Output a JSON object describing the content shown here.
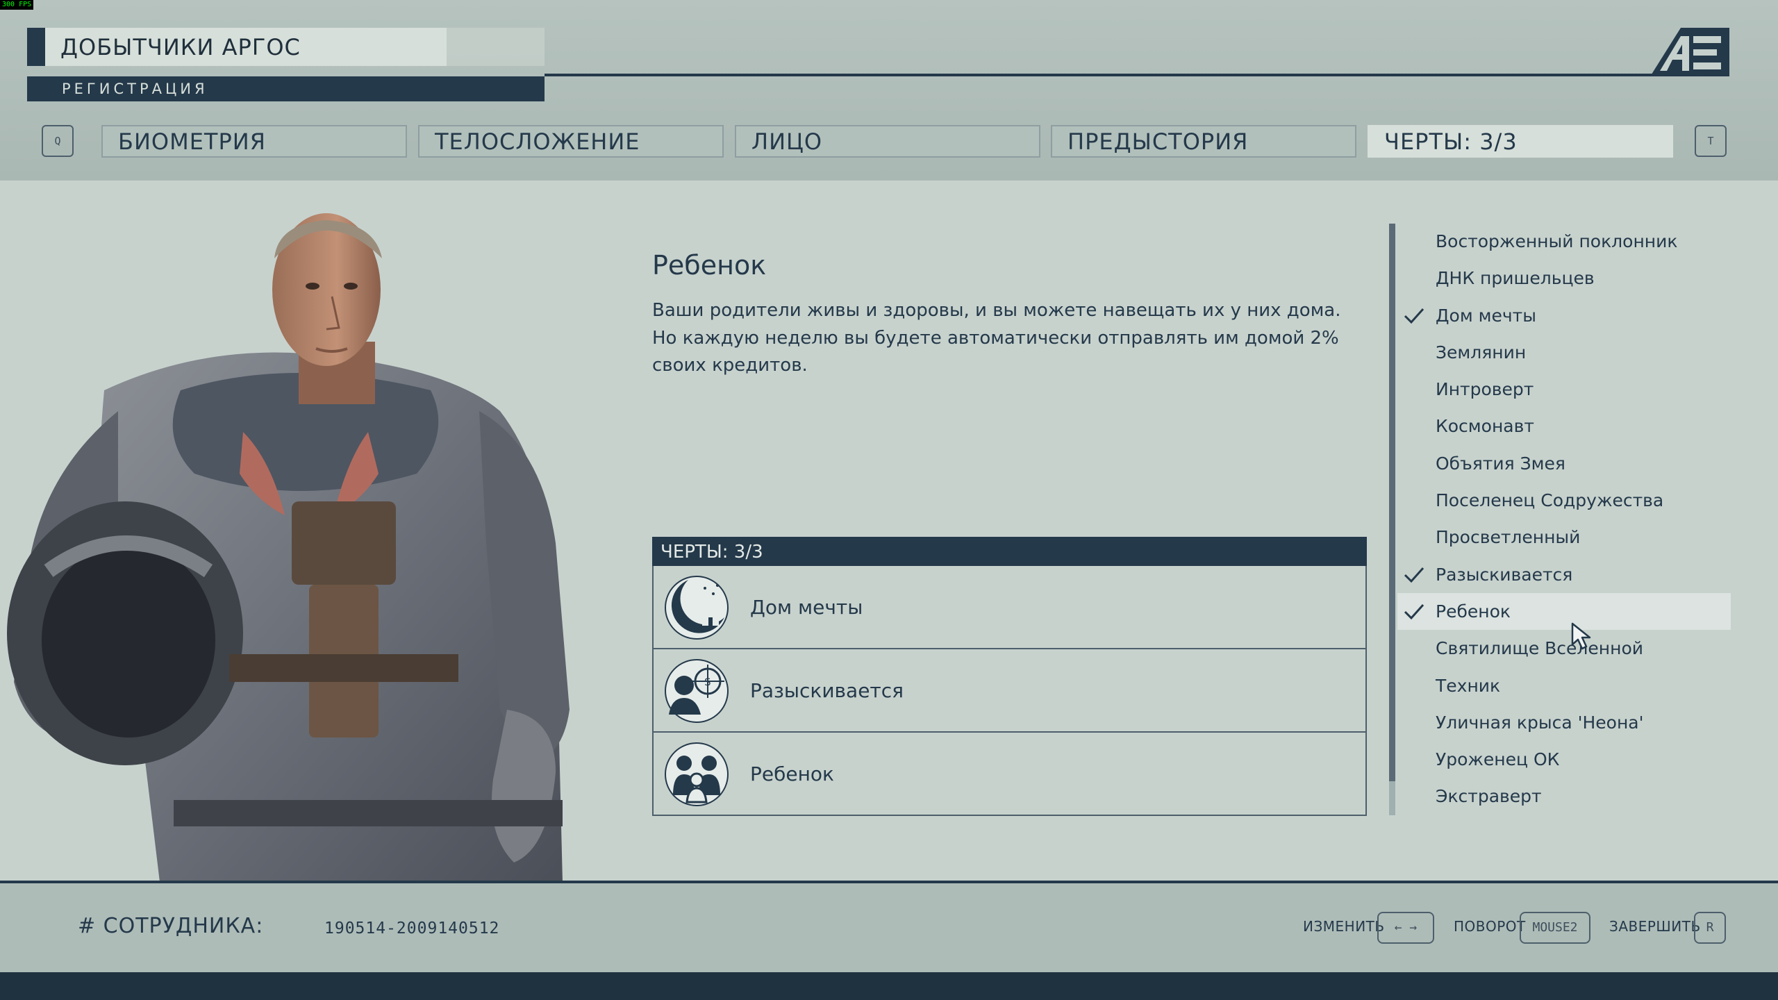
{
  "debug": {
    "fps": "300 FPS"
  },
  "header": {
    "company": "ДОБЫТЧИКИ АРГОС",
    "section": "РЕГИСТРАЦИЯ",
    "prev_key": "Q",
    "next_key": "T",
    "tabs": [
      {
        "label": "БИОМЕТРИЯ",
        "active": false
      },
      {
        "label": "ТЕЛОСЛОЖЕНИЕ",
        "active": false
      },
      {
        "label": "ЛИЦО",
        "active": false
      },
      {
        "label": "ПРЕДЫСТОРИЯ",
        "active": false
      },
      {
        "label": "ЧЕРТЫ: 3/3",
        "active": true
      }
    ]
  },
  "detail": {
    "title": "Ребенок",
    "description": "Ваши родители живы и здоровы, и вы можете навещать их у них дома. Но каждую неделю вы будете автоматически отправлять им домой 2% своих кредитов."
  },
  "selected_traits": {
    "header": "ЧЕРТЫ: 3/3",
    "items": [
      {
        "name": "Дом мечты",
        "icon": "dream-home-icon"
      },
      {
        "name": "Разыскивается",
        "icon": "wanted-icon"
      },
      {
        "name": "Ребенок",
        "icon": "kid-stuff-icon"
      }
    ]
  },
  "trait_list": [
    {
      "name": "Восторженный поклонник",
      "checked": false
    },
    {
      "name": "ДНК пришельцев",
      "checked": false
    },
    {
      "name": "Дом мечты",
      "checked": true
    },
    {
      "name": "Землянин",
      "checked": false
    },
    {
      "name": "Интроверт",
      "checked": false
    },
    {
      "name": "Космонавт",
      "checked": false
    },
    {
      "name": "Объятия Змея",
      "checked": false
    },
    {
      "name": "Поселенец Содружества",
      "checked": false
    },
    {
      "name": "Просветленный",
      "checked": false
    },
    {
      "name": "Разыскивается",
      "checked": true
    },
    {
      "name": "Ребенок",
      "checked": true,
      "selected": true
    },
    {
      "name": "Святилище Вселенной",
      "checked": false
    },
    {
      "name": "Техник",
      "checked": false
    },
    {
      "name": "Уличная крыса 'Неона'",
      "checked": false
    },
    {
      "name": "Уроженец ОК",
      "checked": false
    },
    {
      "name": "Экстраверт",
      "checked": false
    }
  ],
  "footer": {
    "employee_label": "# СОТРУДНИКА:",
    "employee_id": "190514-2009140512",
    "hints": [
      {
        "label": "ИЗМЕНИТЬ",
        "key": "← →"
      },
      {
        "label": "ПОВОРОТ",
        "key": "MOUSE2"
      },
      {
        "label": "ЗАВЕРШИТЬ",
        "key": "R"
      }
    ]
  },
  "colors": {
    "navy": "#24394a",
    "background": "#c8d2cd",
    "selected_row": "#dce3e0",
    "fps_text": "#00ff00"
  }
}
